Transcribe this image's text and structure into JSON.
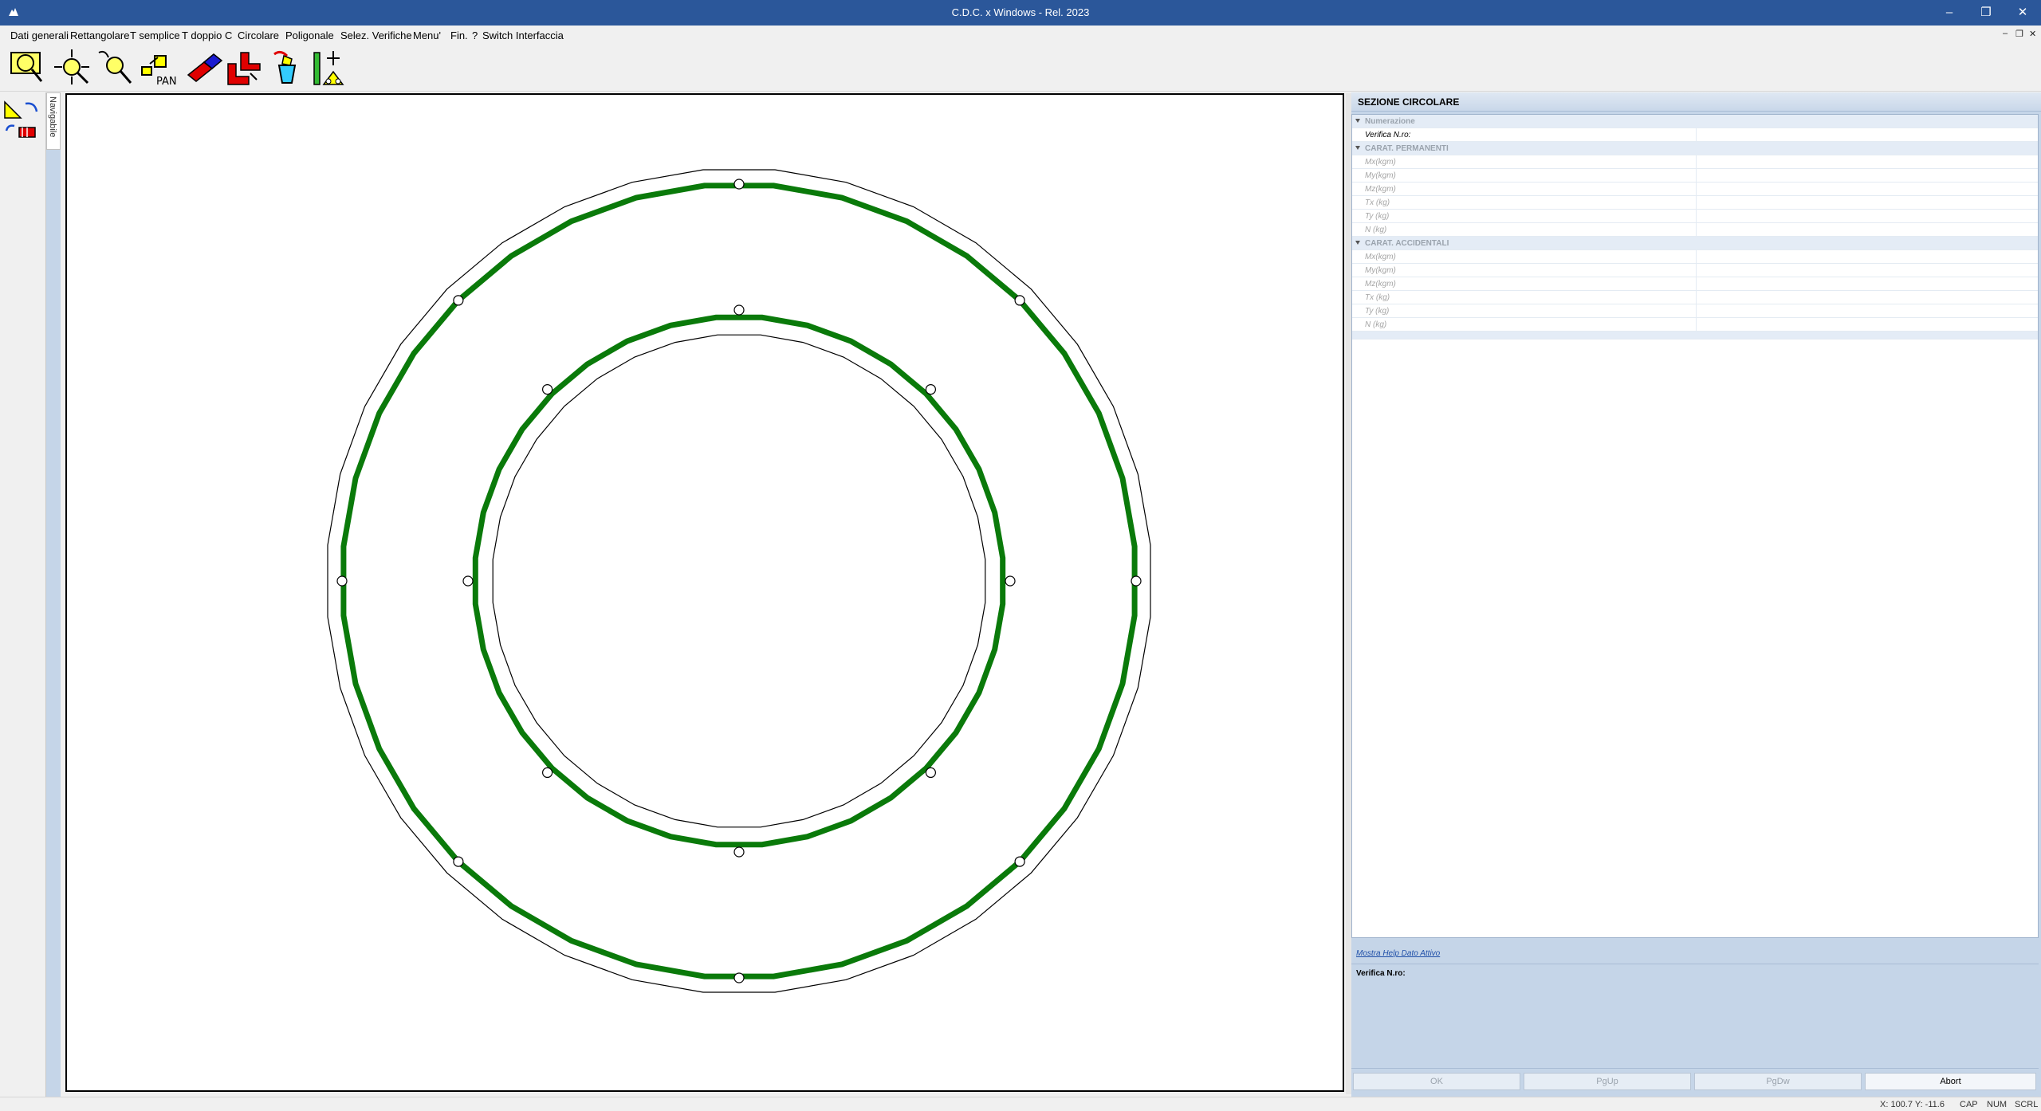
{
  "window": {
    "title": "C.D.C. x Windows - Rel. 2023",
    "minimize": "–",
    "restore": "❐",
    "close": "✕"
  },
  "menu": {
    "items": [
      "Dati generali",
      "Rettangolare",
      "T semplice",
      "T doppio",
      "C",
      "Circolare",
      "Poligonale",
      "Selez. Verifiche",
      "Menu'",
      "Fin.",
      "?",
      "Switch Interfaccia"
    ],
    "mdi_minimize": "–",
    "mdi_restore": "❐",
    "mdi_close": "✕"
  },
  "toolbar": {
    "icons": [
      "zoom-window-icon",
      "zoom-extents-icon",
      "zoom-out-icon",
      "pan-icon",
      "eraser-icon",
      "section-shape-icon",
      "paint-bucket-icon",
      "measure-dimensions-icon"
    ],
    "pan_label": "PAN"
  },
  "sidebar": {
    "icons": [
      "section-tool-icon",
      "rebar-tool-icon"
    ],
    "tab_label": "Navigabile"
  },
  "canvas": {
    "colors": {
      "rebar_ring": "#0a7a0a",
      "outline": "#000000",
      "bar_marker": "#000000"
    }
  },
  "panel": {
    "title": "SEZIONE CIRCOLARE",
    "groups": [
      {
        "name": "Numerazione",
        "rows": [
          {
            "label": "Verifica N.ro:",
            "value": ""
          }
        ]
      },
      {
        "name": "CARAT. PERMANENTI",
        "rows": [
          {
            "label": "Mx(kgm)",
            "value": ""
          },
          {
            "label": "My(kgm)",
            "value": ""
          },
          {
            "label": "Mz(kgm)",
            "value": ""
          },
          {
            "label": "Tx (kg)",
            "value": ""
          },
          {
            "label": "Ty (kg)",
            "value": ""
          },
          {
            "label": "N  (kg)",
            "value": ""
          }
        ]
      },
      {
        "name": "CARAT. ACCIDENTALI",
        "rows": [
          {
            "label": "Mx(kgm)",
            "value": ""
          },
          {
            "label": "My(kgm)",
            "value": ""
          },
          {
            "label": "Mz(kgm)",
            "value": ""
          },
          {
            "label": "Tx (kg)",
            "value": ""
          },
          {
            "label": "Ty (kg)",
            "value": ""
          },
          {
            "label": "N  (kg)",
            "value": ""
          }
        ]
      }
    ],
    "help_link": "Mostra Help Dato Attivo",
    "help_text": "Verifica N.ro:",
    "buttons": {
      "ok": "OK",
      "pgup": "PgUp",
      "pgdw": "PgDw",
      "abort": "Abort"
    }
  },
  "status": {
    "coords": "X: 100.7  Y: -11.6",
    "cap": "CAP",
    "num": "NUM",
    "scrl": "SCRL"
  }
}
